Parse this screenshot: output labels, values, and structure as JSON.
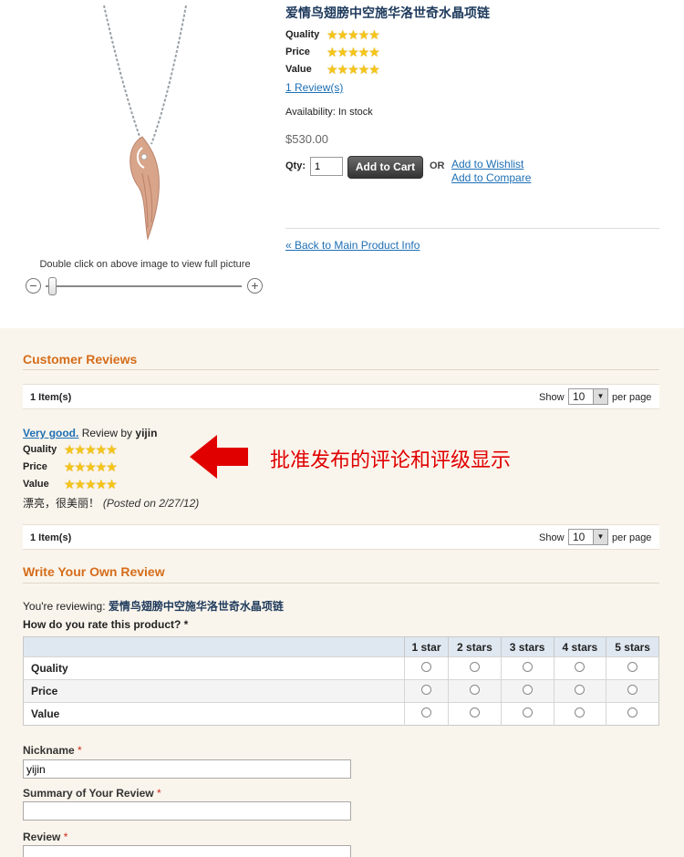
{
  "product": {
    "name": "爱情鸟翅膀中空施华洛世奇水晶项链",
    "ratings": [
      {
        "label": "Quality",
        "stars": 5
      },
      {
        "label": "Price",
        "stars": 5
      },
      {
        "label": "Value",
        "stars": 5
      }
    ],
    "reviews_link": "1 Review(s)",
    "availability": "Availability: In stock",
    "price": "$530.00",
    "qty_label": "Qty:",
    "qty_value": "1",
    "add_to_cart": "Add to Cart",
    "or_label": "OR",
    "wishlist": "Add to Wishlist",
    "compare": "Add to Compare",
    "back_link": "« Back to Main Product Info",
    "image_caption": "Double click on above image to view full picture"
  },
  "customer_reviews": {
    "title": "Customer Reviews",
    "pager_count": "1 Item(s)",
    "show_label": "Show",
    "per_page_value": "10",
    "per_page_label": "per page",
    "review": {
      "title": "Very good.",
      "by_prefix": "Review by",
      "author": "yijin",
      "ratings": [
        {
          "label": "Quality",
          "stars": 5
        },
        {
          "label": "Price",
          "stars": 5
        },
        {
          "label": "Value",
          "stars": 5
        }
      ],
      "body": "漂亮，很美丽！",
      "posted": "(Posted on 2/27/12)"
    },
    "annotation": "批准发布的评论和评级显示"
  },
  "write_review": {
    "title": "Write Your Own Review",
    "reviewing_prefix": "You're reviewing:",
    "product_name": "爱情鸟翅膀中空施华洛世奇水晶项链",
    "how_rate": "How do you rate this product? *",
    "columns": [
      "1 star",
      "2 stars",
      "3 stars",
      "4 stars",
      "5 stars"
    ],
    "rows": [
      "Quality",
      "Price",
      "Value"
    ],
    "nickname_label": "Nickname",
    "nickname_value": "yijin",
    "summary_label": "Summary of Your Review",
    "review_label": "Review",
    "required_mark": "*"
  },
  "colors": {
    "section_title": "#d56d1b",
    "link": "#1e6fb5",
    "annotation": "#e00000",
    "star": "#f5c518"
  }
}
